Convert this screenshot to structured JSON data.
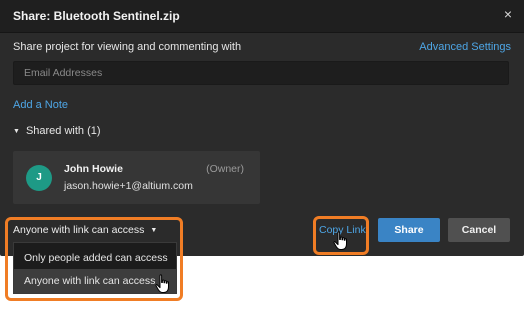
{
  "dialog": {
    "title": "Share: Bluetooth Sentinel.zip",
    "close_glyph": "×",
    "intro": "Share project for viewing and commenting with",
    "advanced_settings": "Advanced Settings",
    "email_placeholder": "Email Addresses",
    "add_note": "Add a Note",
    "shared_with_caret": "▼",
    "shared_with": "Shared with (1)",
    "user": {
      "initial": "J",
      "name": "John Howie",
      "role": "(Owner)",
      "email": "jason.howie+1@altium.com"
    },
    "access_toggle": "Anyone with link can access",
    "access_caret": "▼",
    "copy_link": "Copy Link",
    "share_button": "Share",
    "cancel_button": "Cancel"
  },
  "access_dropdown": {
    "options": [
      "Only people added can access",
      "Anyone with link can access"
    ],
    "selected": "Anyone with link can access"
  },
  "icons": {
    "close": "close-icon",
    "caret": "caret-down-icon",
    "cursor": "hand-pointer-icon"
  },
  "colors": {
    "accent_link": "#4ea6e6",
    "primary_button": "#3a84c5",
    "avatar": "#1e9a86",
    "highlight": "#f07d25"
  }
}
